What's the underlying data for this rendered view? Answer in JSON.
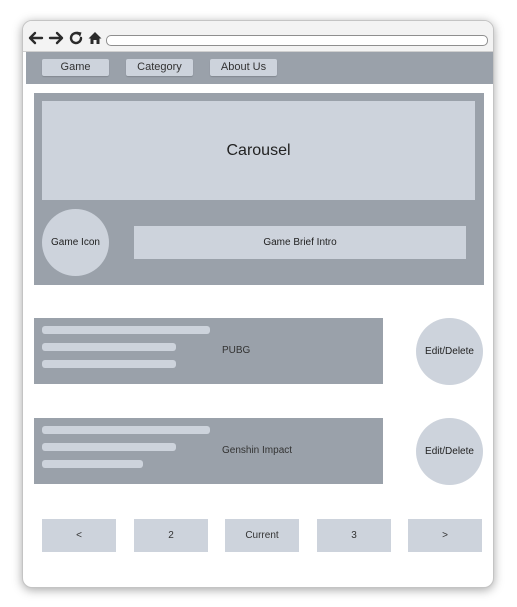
{
  "browser": {
    "icons": [
      "back-arrow-icon",
      "forward-arrow-icon",
      "reload-icon",
      "home-icon"
    ],
    "address_value": ""
  },
  "nav": {
    "items": [
      {
        "label": "Game"
      },
      {
        "label": "Category"
      },
      {
        "label": "About Us"
      }
    ]
  },
  "hero": {
    "carousel_label": "Carousel",
    "game_icon_label": "Game Icon",
    "brief_label": "Game Brief Intro"
  },
  "games": [
    {
      "title": "PUBG",
      "action_label": "Edit/Delete"
    },
    {
      "title": "Genshin Impact",
      "action_label": "Edit/Delete"
    }
  ],
  "pagination": {
    "prev": "<",
    "items": [
      "2",
      "Current",
      "3"
    ],
    "next": ">"
  },
  "colors": {
    "panel": "#9aa1aa",
    "placeholder": "#cdd3dc"
  }
}
